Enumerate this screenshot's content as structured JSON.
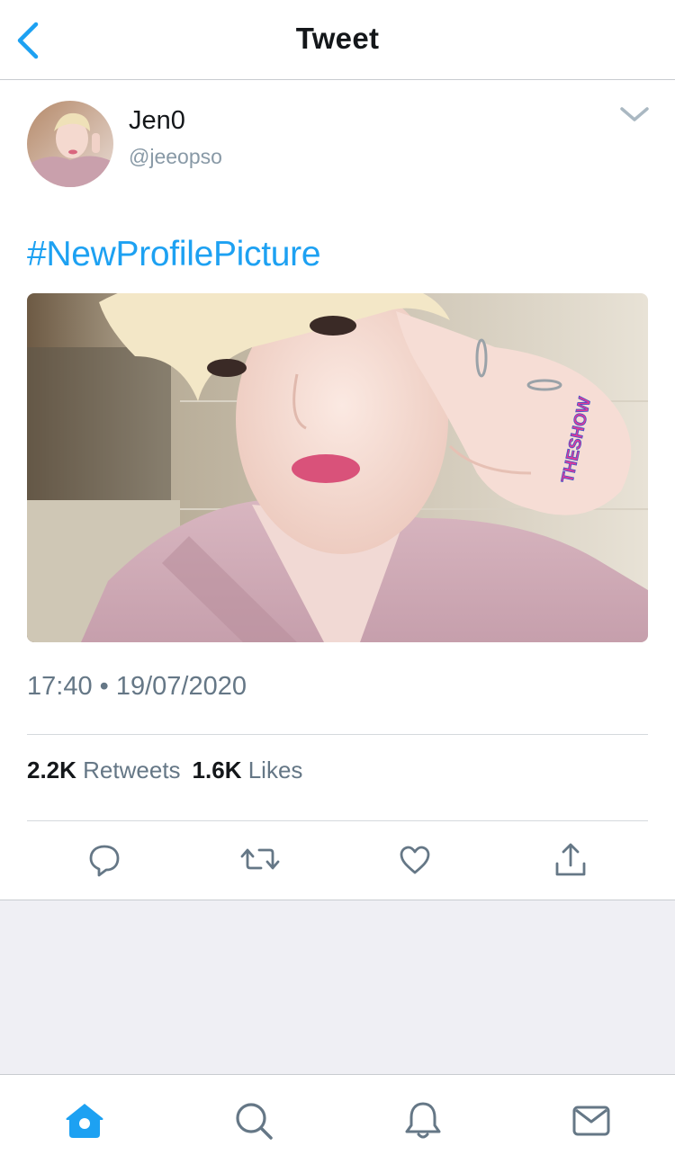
{
  "header": {
    "title": "Tweet",
    "back_icon": "chevron-left-icon"
  },
  "tweet": {
    "author": {
      "display_name": "Jen0",
      "handle": "@jeeopso",
      "avatar_icon": "avatar"
    },
    "menu_icon": "chevron-down-icon",
    "text": "#NewProfilePicture",
    "photo": {
      "sticker_text": "THESHOW"
    },
    "timestamp": "17:40 • 19/07/2020",
    "stats": {
      "retweets_count": "2.2K",
      "retweets_label": "Retweets",
      "likes_count": "1.6K",
      "likes_label": "Likes"
    },
    "actions": [
      "reply-icon",
      "retweet-icon",
      "like-icon",
      "share-icon"
    ]
  },
  "tabbar": {
    "tabs": [
      "home-icon",
      "search-icon",
      "notifications-icon",
      "messages-icon"
    ],
    "active": "home-icon"
  },
  "colors": {
    "accent": "#1da1f2",
    "text": "#14171a",
    "secondary": "#657786",
    "muted": "#8899a6",
    "background_gray": "#efeff4",
    "divider": "#d5d9dd"
  }
}
